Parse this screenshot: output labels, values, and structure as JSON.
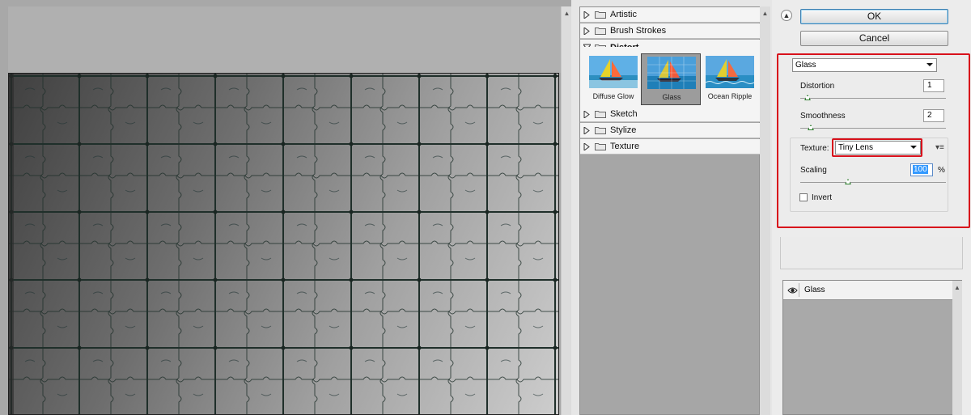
{
  "gallery": {
    "folders_top": [
      {
        "label": "Artistic",
        "expanded": false
      },
      {
        "label": "Brush Strokes",
        "expanded": false
      },
      {
        "label": "Distort",
        "expanded": true
      }
    ],
    "thumbnails": [
      {
        "label": "Diffuse Glow",
        "selected": false
      },
      {
        "label": "Glass",
        "selected": true
      },
      {
        "label": "Ocean Ripple",
        "selected": false
      }
    ],
    "folders_bottom": [
      {
        "label": "Sketch",
        "expanded": false
      },
      {
        "label": "Stylize",
        "expanded": false
      },
      {
        "label": "Texture",
        "expanded": false
      }
    ]
  },
  "settings": {
    "ok_label": "OK",
    "cancel_label": "Cancel",
    "filter_value": "Glass",
    "distortion_label": "Distortion",
    "distortion_value": "1",
    "smoothness_label": "Smoothness",
    "smoothness_value": "2",
    "texture_label": "Texture:",
    "texture_value": "Tiny Lens",
    "scaling_label": "Scaling",
    "scaling_value": "100",
    "scaling_unit": "%",
    "invert_label": "Invert",
    "invert_checked": false
  },
  "layers": {
    "items": [
      {
        "name": "Glass",
        "visible": true
      }
    ]
  },
  "colors": {
    "highlight_red": "#d8111b",
    "slider_green": "#2e7f2e",
    "selection_blue": "#3399ff"
  }
}
